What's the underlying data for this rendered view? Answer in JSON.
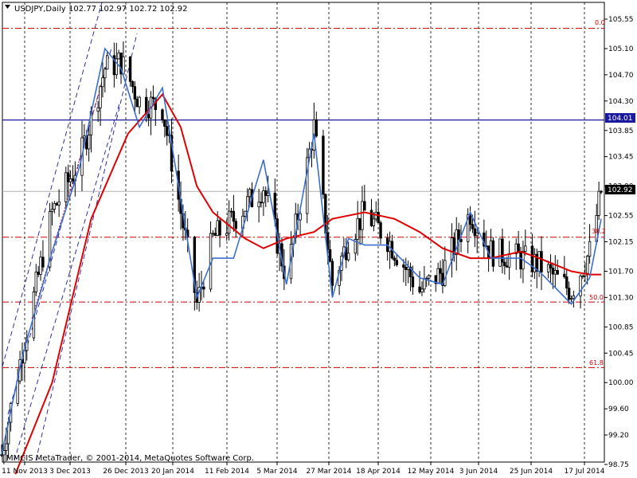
{
  "chart_title": "USDJPY,Daily",
  "ohlc_header": "102.77 102.97 102.72 102.92",
  "copyright": "MMCIS MetaTrader, © 2001-2014, MetaQuotes Software Corp.",
  "price_axis_ticks": [
    "105.55",
    "105.10",
    "104.70",
    "104.30",
    "103.85",
    "103.45",
    "103.00",
    "102.55",
    "102.15",
    "101.70",
    "101.30",
    "100.85",
    "100.45",
    "100.00",
    "99.60",
    "99.20",
    "98.75"
  ],
  "date_axis_ticks": [
    "11 Nov 2013",
    "3 Dec 2013",
    "26 Dec 2013",
    "20 Jan 2014",
    "11 Feb 2014",
    "5 Mar 2014",
    "27 Mar 2014",
    "18 Apr 2014",
    "12 May 2014",
    "3 Jun 2014",
    "25 Jun 2014",
    "17 Jul 2014"
  ],
  "current_price_label": "102.92",
  "horizontal_line_label": "104.01",
  "fib_labels": {
    "level_0": "0.0",
    "level_382": "38.2",
    "level_50": "50.0",
    "level_618": "61.8"
  },
  "colors": {
    "candle": "#000000",
    "blue_ma": "#3A6FD0",
    "red_ma": "#E00000",
    "hline": "#1A1A9E",
    "fib": "#D00000",
    "channel": "#1A1AA0",
    "grid": "#000000",
    "price_tag_bg": "#000000",
    "hline_tag_bg": "#1A1A9E"
  },
  "chart_data": {
    "type": "candlestick",
    "title": "USDJPY,Daily",
    "ylim": [
      98.65,
      105.75
    ],
    "x_start": "2013-11-11",
    "x_end": "2014-07-30",
    "series": [
      {
        "name": "close_approx",
        "x": [
          "2013-11-11",
          "2013-11-20",
          "2013-12-03",
          "2013-12-15",
          "2013-12-26",
          "2014-01-02",
          "2014-01-10",
          "2014-01-20",
          "2014-01-28",
          "2014-02-04",
          "2014-02-11",
          "2014-02-20",
          "2014-03-05",
          "2014-03-15",
          "2014-03-27",
          "2014-04-04",
          "2014-04-11",
          "2014-04-18",
          "2014-04-28",
          "2014-05-12",
          "2014-05-22",
          "2014-06-03",
          "2014-06-12",
          "2014-06-25",
          "2014-07-03",
          "2014-07-17",
          "2014-07-25",
          "2014-07-30"
        ],
        "values": [
          98.9,
          100.5,
          102.6,
          103.4,
          104.8,
          104.9,
          104.3,
          104.2,
          102.6,
          101.2,
          102.2,
          102.5,
          103.0,
          101.6,
          103.9,
          101.5,
          102.2,
          102.6,
          102.2,
          101.4,
          101.7,
          102.6,
          102.0,
          101.9,
          101.8,
          101.4,
          102.0,
          102.92
        ]
      },
      {
        "name": "blue_ma",
        "x": [
          "2013-11-11",
          "2013-11-20",
          "2013-12-03",
          "2013-12-15",
          "2013-12-26",
          "2014-01-02",
          "2014-01-10",
          "2014-01-20",
          "2014-01-28",
          "2014-02-04",
          "2014-02-11",
          "2014-02-20",
          "2014-03-05",
          "2014-03-15",
          "2014-03-27",
          "2014-04-04",
          "2014-04-11",
          "2014-04-18",
          "2014-04-28",
          "2014-05-12",
          "2014-05-22",
          "2014-06-03",
          "2014-06-12",
          "2014-06-25",
          "2014-07-03",
          "2014-07-17",
          "2014-07-25",
          "2014-07-30"
        ],
        "values": [
          98.9,
          100.4,
          102.0,
          103.3,
          105.1,
          104.8,
          103.9,
          104.5,
          102.8,
          101.3,
          101.9,
          101.9,
          103.4,
          101.5,
          103.8,
          101.3,
          102.2,
          102.1,
          102.1,
          101.6,
          101.5,
          102.6,
          101.9,
          101.9,
          101.7,
          101.2,
          101.6,
          102.5
        ]
      },
      {
        "name": "red_ma",
        "x": [
          "2013-11-17",
          "2013-12-03",
          "2013-12-20",
          "2014-01-05",
          "2014-01-20",
          "2014-01-28",
          "2014-02-04",
          "2014-02-11",
          "2014-02-25",
          "2014-03-05",
          "2014-03-15",
          "2014-03-27",
          "2014-04-04",
          "2014-04-18",
          "2014-05-01",
          "2014-05-12",
          "2014-05-22",
          "2014-06-03",
          "2014-06-12",
          "2014-06-25",
          "2014-07-03",
          "2014-07-17",
          "2014-07-25",
          "2014-07-30"
        ],
        "values": [
          98.6,
          100.0,
          102.5,
          103.8,
          104.4,
          103.9,
          103.0,
          102.6,
          102.2,
          102.05,
          102.2,
          102.3,
          102.5,
          102.6,
          102.5,
          102.3,
          102.05,
          101.9,
          101.9,
          102.0,
          101.9,
          101.7,
          101.65,
          101.65
        ]
      }
    ],
    "horizontal_lines": [
      104.01
    ],
    "fibonacci_levels": [
      {
        "label": "0.0",
        "value": 105.41
      },
      {
        "label": "38.2",
        "value": 102.22
      },
      {
        "label": "50.0",
        "value": 101.23
      },
      {
        "label": "61.8",
        "value": 100.23
      }
    ],
    "last_price": 102.92
  }
}
